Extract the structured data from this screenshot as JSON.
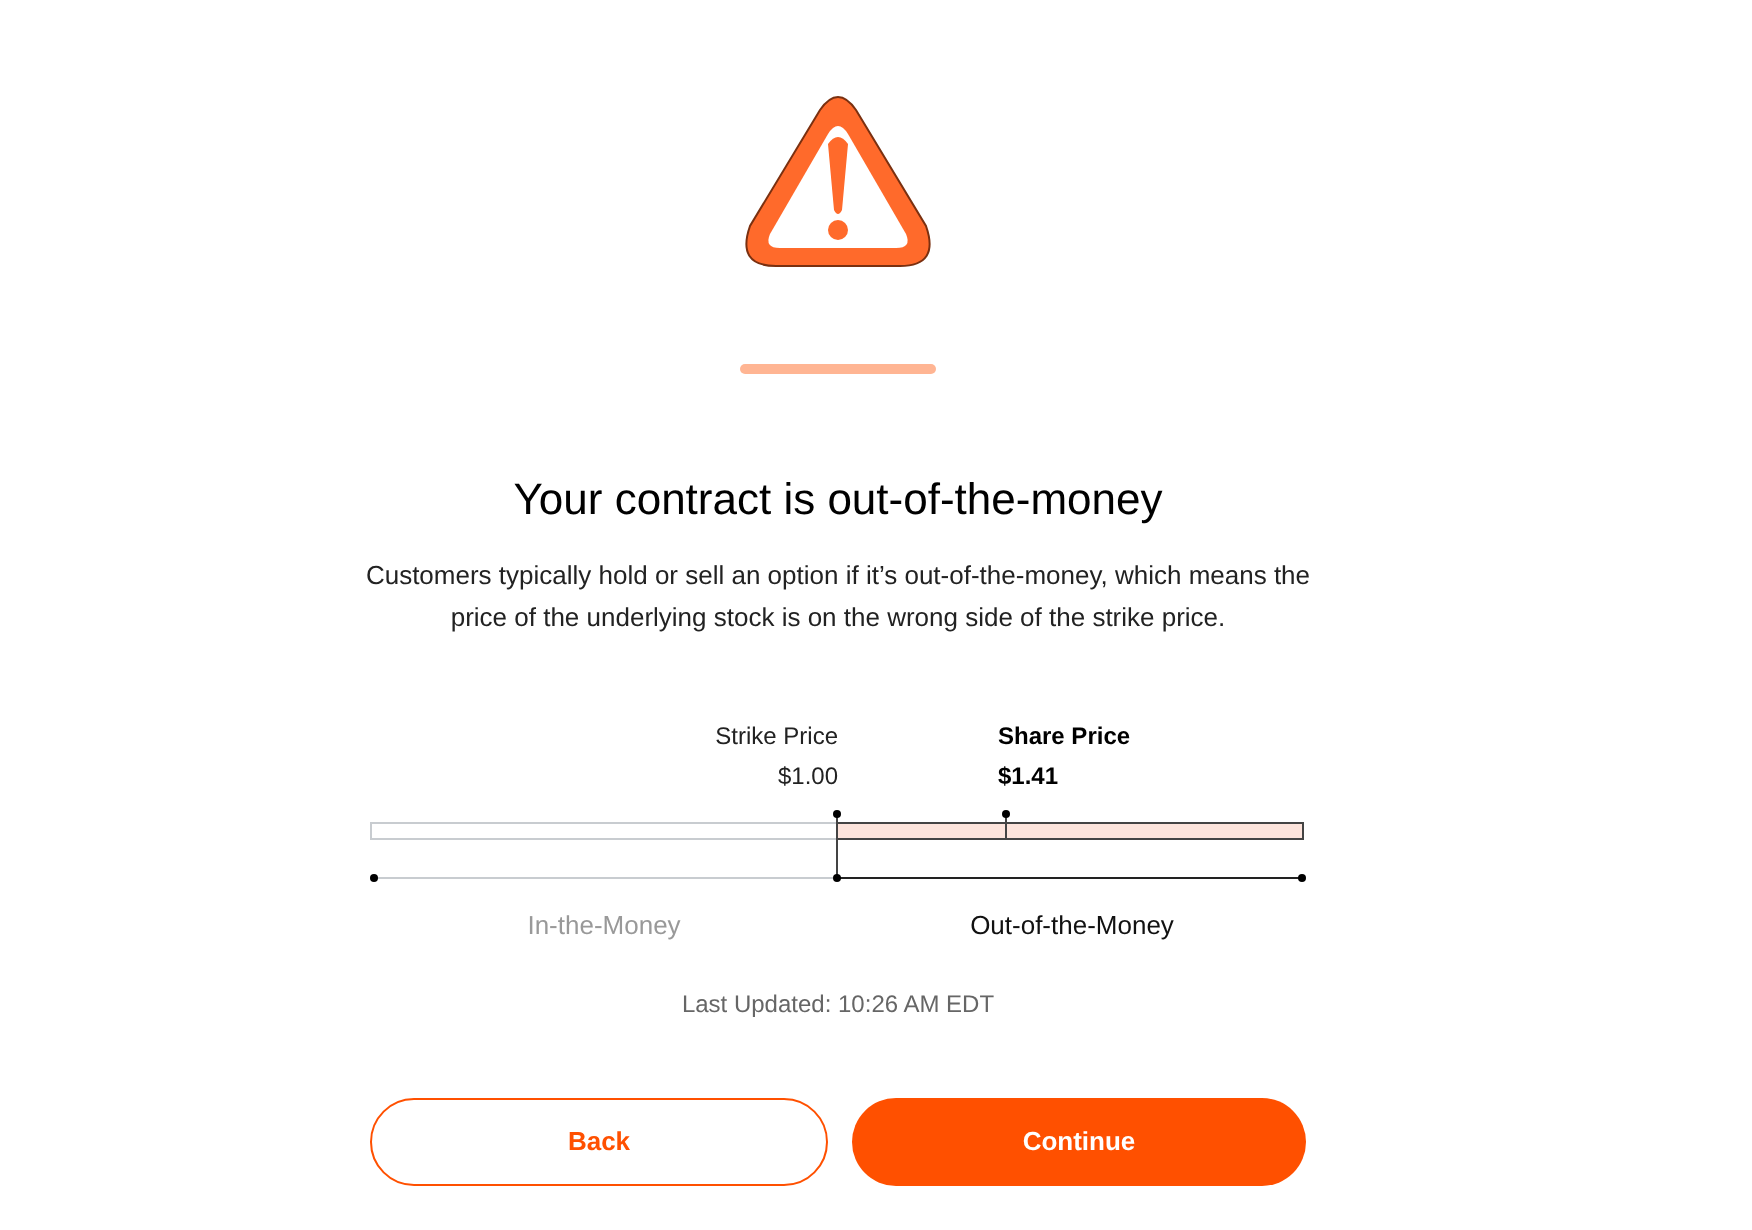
{
  "title": "Your contract is out-of-the-money",
  "description": "Customers typically hold or sell an option if it’s out-of-the-money, which means the price of the underlying stock is on the wrong side of the strike price.",
  "strike": {
    "label": "Strike Price",
    "value": "$1.00"
  },
  "share": {
    "label": "Share Price",
    "value": "$1.41"
  },
  "zones": [
    {
      "label": "In-the-Money",
      "selected": false
    },
    {
      "label": "Out-of-the-Money",
      "selected": true
    }
  ],
  "last_updated": "Last Updated: 10:26 AM EDT",
  "buttons": [
    {
      "label": "Back",
      "kind": "secondary"
    },
    {
      "label": "Continue",
      "kind": "primary"
    }
  ]
}
